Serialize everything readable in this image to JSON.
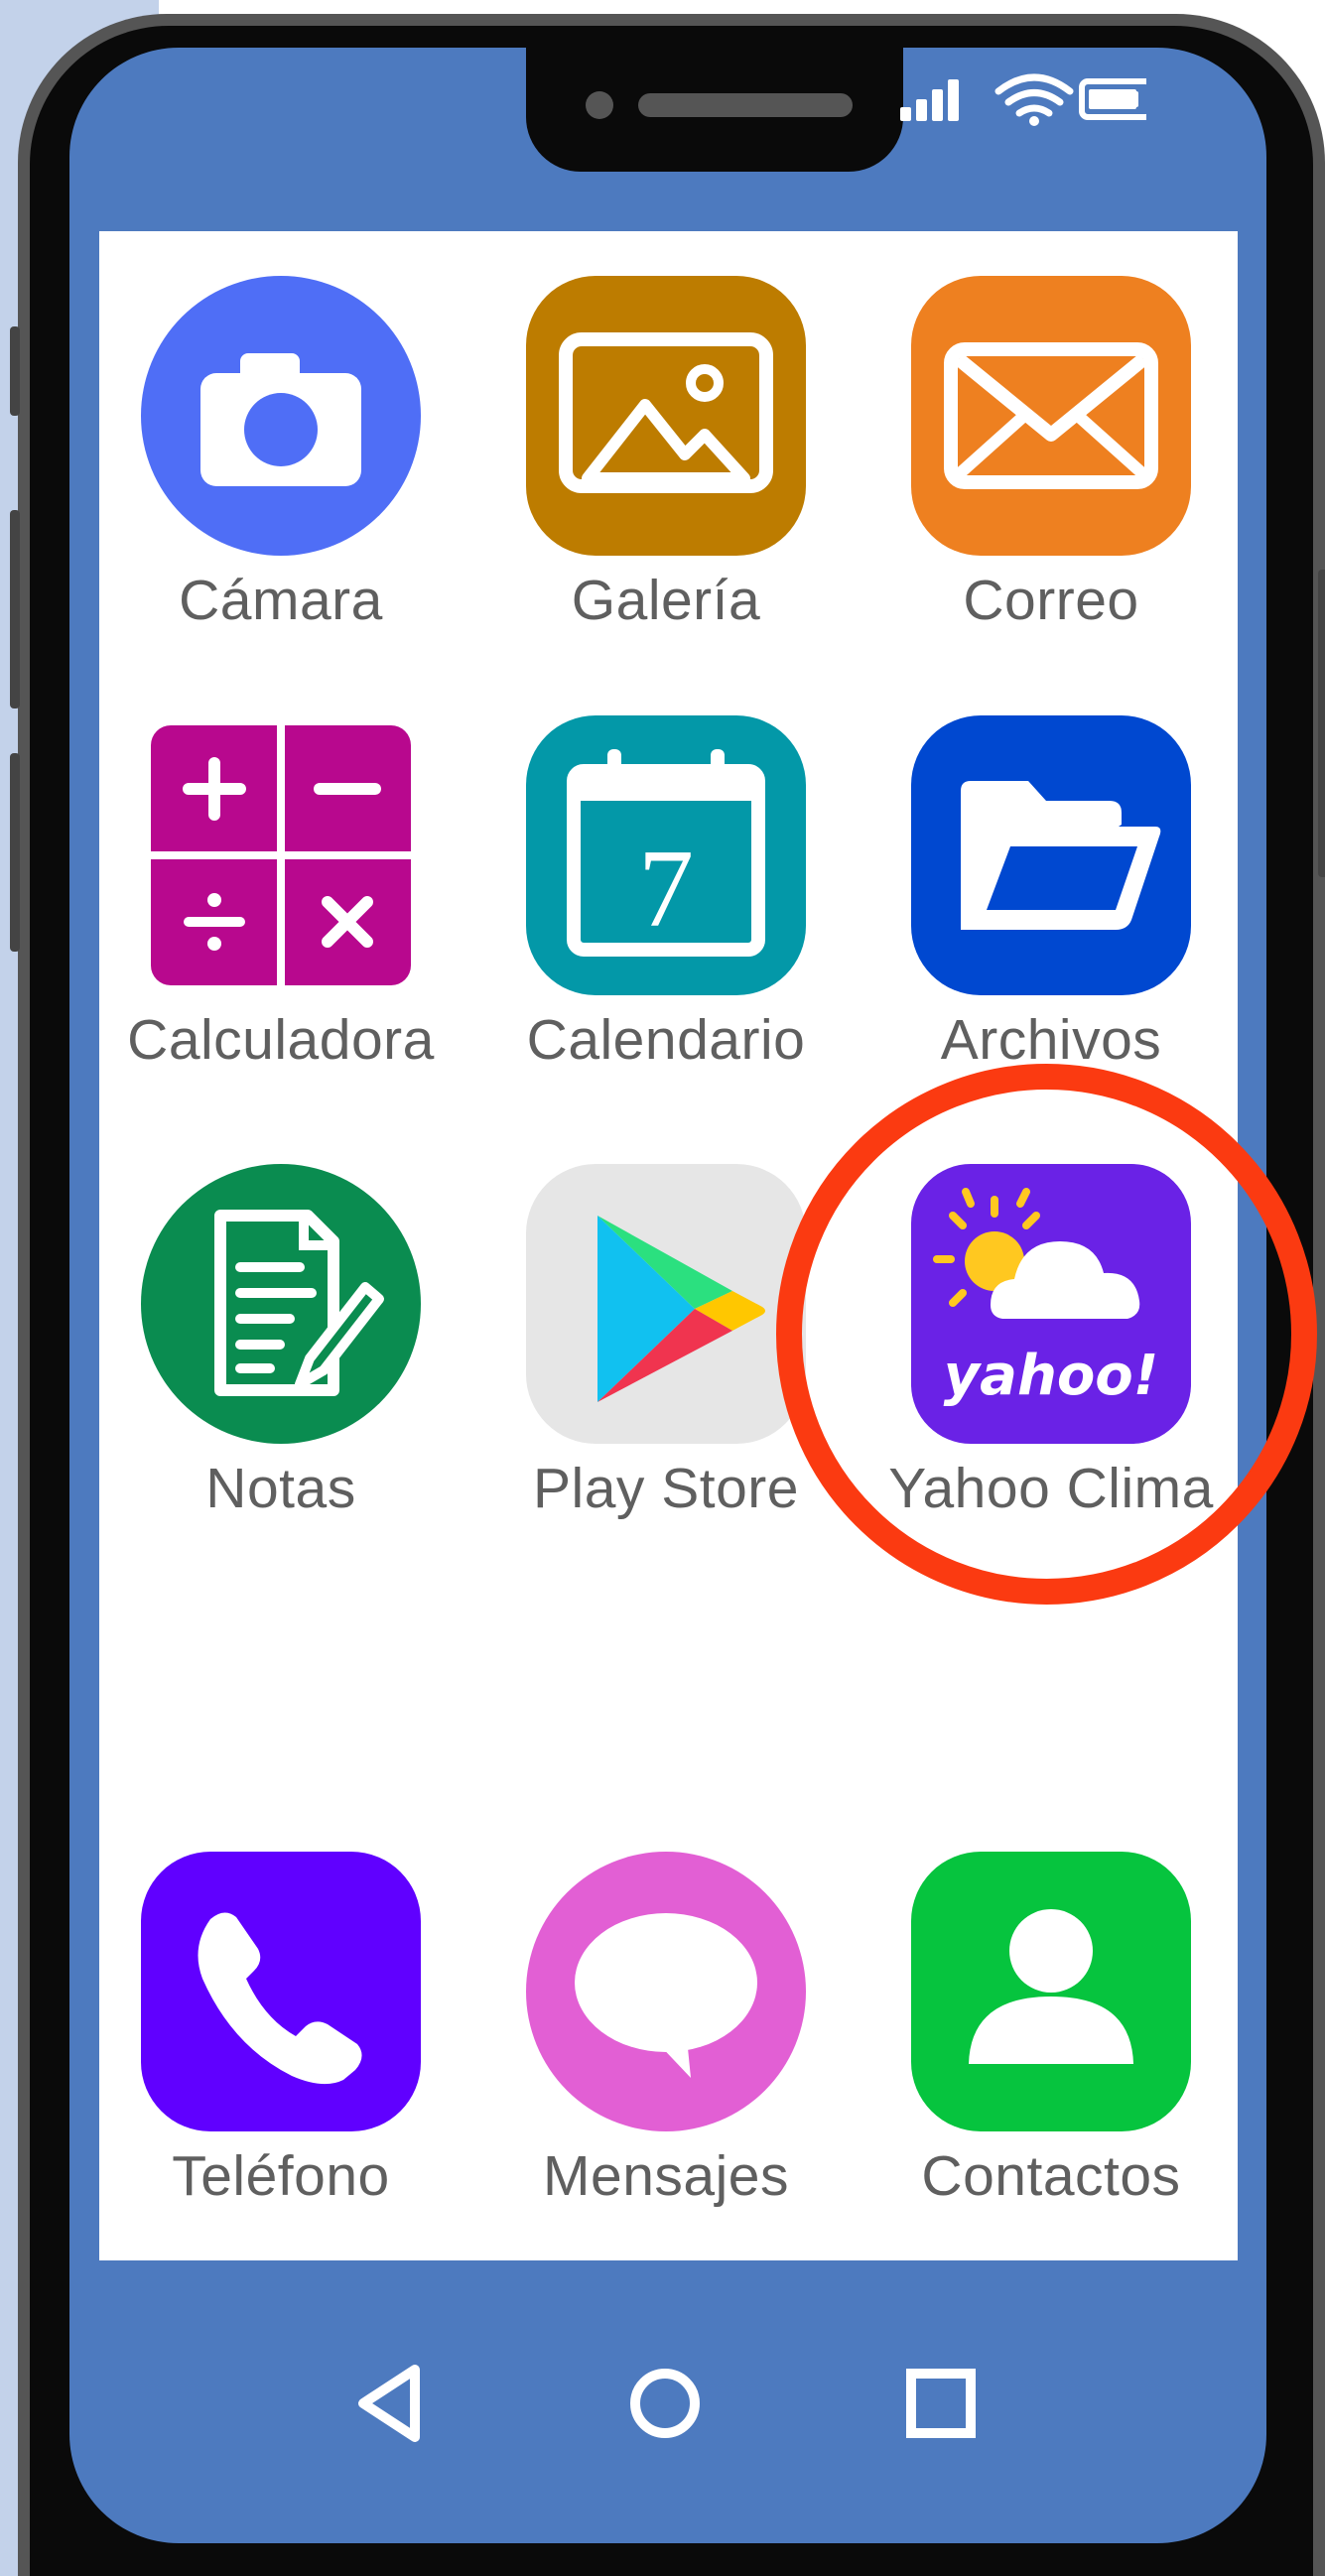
{
  "status_bar": {
    "icons": [
      "signal-icon",
      "wifi-icon",
      "battery-icon"
    ]
  },
  "apps": [
    {
      "label": "Cámara",
      "icon": "camera-icon",
      "color": "#4f6ef6"
    },
    {
      "label": "Galería",
      "icon": "gallery-icon",
      "color": "#bd7c00"
    },
    {
      "label": "Correo",
      "icon": "mail-icon",
      "color": "#ee8020"
    },
    {
      "label": "Calculadora",
      "icon": "calculator-icon",
      "color": "#b8088e"
    },
    {
      "label": "Calendario",
      "icon": "calendar-icon",
      "color": "#0398a8",
      "day": "7"
    },
    {
      "label": "Archivos",
      "icon": "folder-icon",
      "color": "#0048d0"
    },
    {
      "label": "Notas",
      "icon": "notes-icon",
      "color": "#0a8c50"
    },
    {
      "label": "Play Store",
      "icon": "play-store-icon",
      "color": "#e6e6e6"
    },
    {
      "label": "Yahoo Clima",
      "icon": "yahoo-weather-icon",
      "color": "#6a22e6",
      "brand": "yahoo!"
    },
    {
      "label": "Teléfono",
      "icon": "phone-icon",
      "color": "#6000ff"
    },
    {
      "label": "Mensajes",
      "icon": "messages-icon",
      "color": "#e25fd4"
    },
    {
      "label": "Contactos",
      "icon": "contacts-icon",
      "color": "#06c43e"
    }
  ],
  "nav_bar": {
    "buttons": [
      "back-icon",
      "home-icon",
      "recents-icon"
    ]
  },
  "highlight_color": "#fb3a11"
}
